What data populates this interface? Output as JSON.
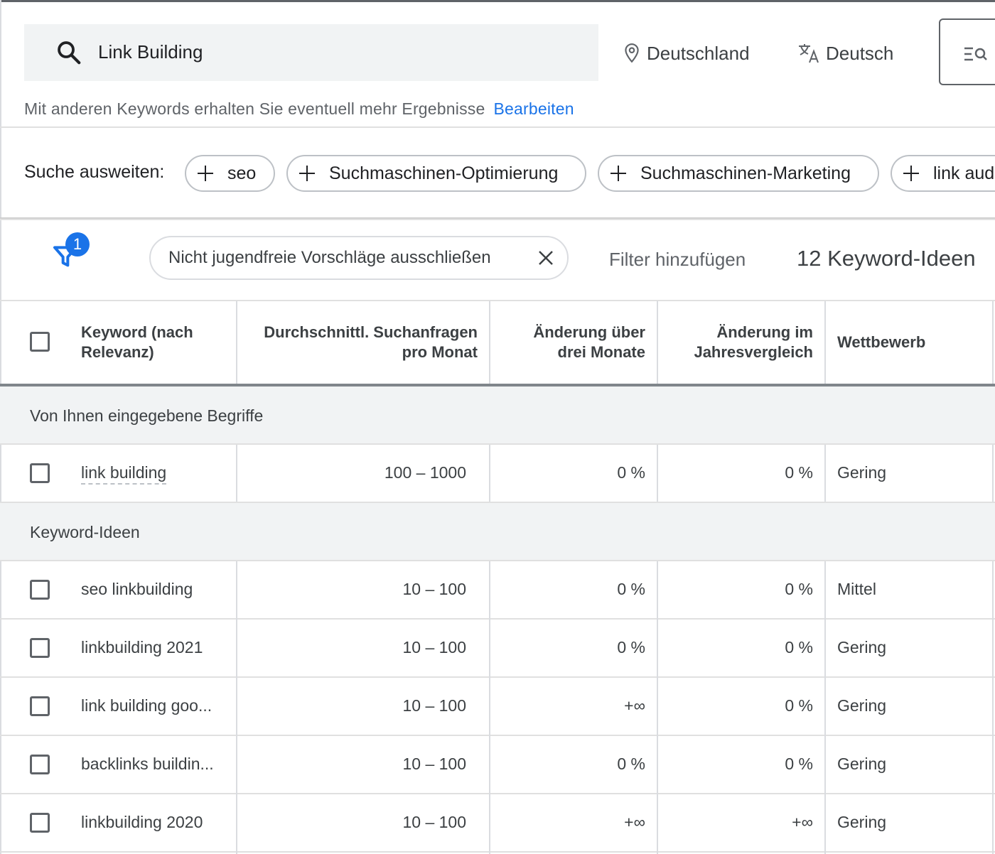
{
  "search": {
    "query": "Link Building",
    "location": "Deutschland",
    "language": "Deutsch",
    "hint": "Mit anderen Keywords erhalten Sie eventuell mehr Ergebnisse",
    "edit_link": "Bearbeiten"
  },
  "expand": {
    "label": "Suche ausweiten:",
    "chips": [
      "seo",
      "Suchmaschinen-Optimierung",
      "Suchmaschinen-Marketing",
      "link aud"
    ]
  },
  "filters": {
    "badge_count": "1",
    "active_filter": "Nicht jugendfreie Vorschläge ausschließen",
    "add_filter": "Filter hinzufügen",
    "ideas_count": "12 Keyword-Ideen"
  },
  "table": {
    "headers": {
      "keyword": [
        "Keyword (nach",
        "Relevanz)"
      ],
      "avg_searches": [
        "Durchschnittl. Suchanfragen",
        "pro Monat"
      ],
      "three_month": [
        "Änderung über",
        "drei Monate"
      ],
      "yoy": [
        "Änderung im",
        "Jahresvergleich"
      ],
      "competition": "Wettbewerb"
    },
    "section_entered": "Von Ihnen eingegebene Begriffe",
    "entered_row": {
      "keyword": "link building",
      "avg": "100 – 1000",
      "three_month": "0 %",
      "yoy": "0 %",
      "competition": "Gering"
    },
    "section_ideas": "Keyword-Ideen",
    "rows": [
      {
        "keyword": "seo linkbuilding",
        "avg": "10 – 100",
        "three_month": "0 %",
        "yoy": "0 %",
        "competition": "Mittel"
      },
      {
        "keyword": "linkbuilding 2021",
        "avg": "10 – 100",
        "three_month": "0 %",
        "yoy": "0 %",
        "competition": "Gering"
      },
      {
        "keyword": "link building goo...",
        "avg": "10 – 100",
        "three_month": "+∞",
        "yoy": "0 %",
        "competition": "Gering"
      },
      {
        "keyword": "backlinks buildin...",
        "avg": "10 – 100",
        "three_month": "0 %",
        "yoy": "0 %",
        "competition": "Gering"
      },
      {
        "keyword": "linkbuilding 2020",
        "avg": "10 – 100",
        "three_month": "+∞",
        "yoy": "+∞",
        "competition": "Gering"
      }
    ]
  },
  "colors": {
    "accent": "#1a73e8",
    "section_bg": "#f1f3f4",
    "text": "#3c4043"
  }
}
